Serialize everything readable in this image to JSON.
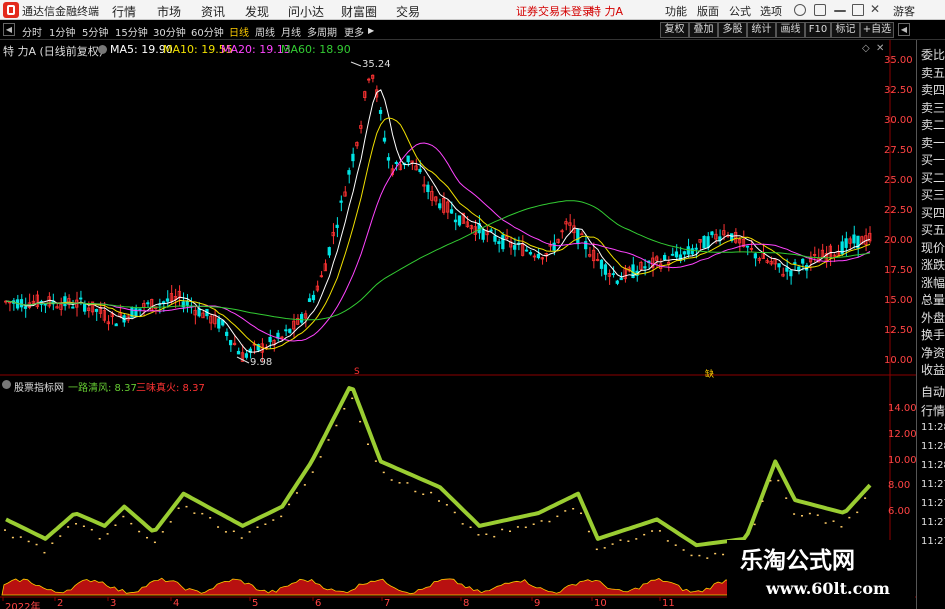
{
  "topbar": {
    "app_title": "通达信金融终端",
    "menus": [
      "行情",
      "市场",
      "资讯",
      "发现",
      "问小达",
      "财富圈",
      "交易"
    ],
    "trade_status": "证券交易未登录",
    "stock_name": "特 力A",
    "right_menus": [
      "功能",
      "版面",
      "公式",
      "选项"
    ],
    "guest": "游客"
  },
  "toolbar": {
    "periods": [
      "分时",
      "1分钟",
      "5分钟",
      "15分钟",
      "30分钟",
      "60分钟",
      "日线",
      "周线",
      "月线",
      "多周期",
      "更多"
    ],
    "active_period": "日线",
    "right_buttons": [
      "复权",
      "叠加",
      "多股",
      "统计",
      "画线",
      "F10",
      "标记",
      "+自选"
    ]
  },
  "main_chart": {
    "title": "特 力A (日线前复权)",
    "ma_labels": [
      {
        "label": "MA5: 19.90",
        "color": "#ffffff"
      },
      {
        "label": "MA10: 19.55",
        "color": "#f0e000"
      },
      {
        "label": "MA20: 19.13",
        "color": "#ff44ff"
      },
      {
        "label": "MA60: 18.90",
        "color": "#33cc33"
      }
    ],
    "high_marker": "35.24",
    "low_marker": "9.98",
    "y_ticks": [
      "35.00",
      "32.50",
      "30.00",
      "27.50",
      "25.00",
      "22.50",
      "20.00",
      "17.50",
      "15.00",
      "12.50",
      "10.00"
    ],
    "event_markers": [
      "S",
      "缺"
    ]
  },
  "sub_chart": {
    "title": "股票指标网",
    "series": [
      {
        "label": "一路清风: 8.37",
        "color": "#66cc33"
      },
      {
        "label": "三味真火: 8.37",
        "color": "#ff3333"
      }
    ],
    "y_ticks": [
      "14.00",
      "12.00",
      "10.00",
      "8.00",
      "6.00"
    ]
  },
  "x_axis": [
    "2022年",
    "2",
    "3",
    "4",
    "5",
    "6",
    "7",
    "8",
    "9",
    "10",
    "11"
  ],
  "right_panel": {
    "labels": [
      "委比",
      "卖五",
      "卖四",
      "卖三",
      "卖二",
      "卖一",
      "买一",
      "买二",
      "买三",
      "买四",
      "买五",
      "现价",
      "涨跌",
      "涨幅",
      "总量",
      "外盘",
      "换手",
      "净资",
      "收益",
      "自动",
      "行情"
    ],
    "times": [
      "11:28",
      "11:28",
      "11:28",
      "11:27",
      "11:27",
      "11:27",
      "11:27"
    ],
    "corner": "L R"
  },
  "watermark": {
    "text": "乐淘公式网",
    "url": "www.60lt.com"
  },
  "colors": {
    "up": "#ff3333",
    "down": "#00e5e5",
    "ma5": "#ffffff",
    "ma10": "#f0e000",
    "ma20": "#ff44ff",
    "ma60": "#33cc33",
    "indicator": "#9acd32",
    "fill": "#b81010"
  }
}
